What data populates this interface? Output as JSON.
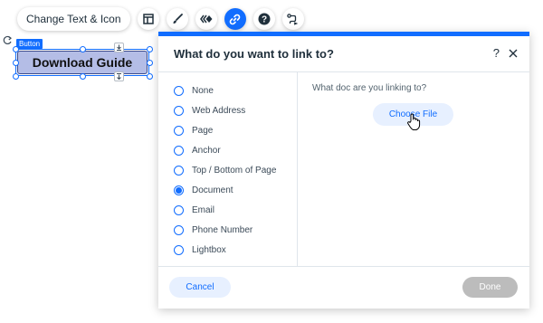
{
  "toolbar": {
    "change_text_label": "Change Text & Icon",
    "icons": [
      "layout-icon",
      "brush-icon",
      "animation-icon",
      "link-icon",
      "help-icon",
      "connect-icon"
    ],
    "active_icon": "link-icon"
  },
  "canvas": {
    "selection_tag": "Button",
    "button_label": "Download Guide"
  },
  "dialog": {
    "title": "What do you want to link to?",
    "help_label": "?",
    "options": [
      {
        "label": "None",
        "checked": false
      },
      {
        "label": "Web Address",
        "checked": false
      },
      {
        "label": "Page",
        "checked": false
      },
      {
        "label": "Anchor",
        "checked": false
      },
      {
        "label": "Top / Bottom of Page",
        "checked": false
      },
      {
        "label": "Document",
        "checked": true
      },
      {
        "label": "Email",
        "checked": false
      },
      {
        "label": "Phone Number",
        "checked": false
      },
      {
        "label": "Lightbox",
        "checked": false
      }
    ],
    "right_prompt": "What doc are you linking to?",
    "choose_file_label": "Choose File",
    "cancel_label": "Cancel",
    "done_label": "Done"
  },
  "colors": {
    "accent": "#116dff",
    "accent_light": "#e7f0ff",
    "button_fill": "#b4bde6",
    "disabled": "#bcbcbc"
  }
}
